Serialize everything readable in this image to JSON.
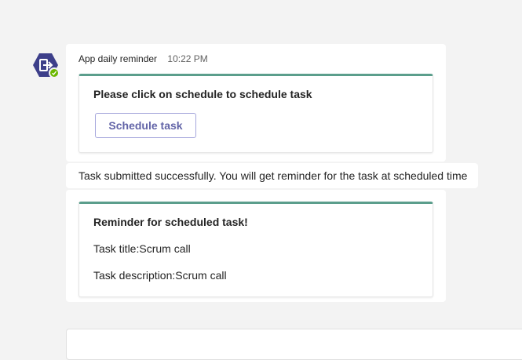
{
  "colors": {
    "background": "#f3f3f3",
    "accent": "#5b9e8c",
    "button_text": "#6264a7",
    "avatar_bg": "#3d3f8a",
    "status_online": "#6bb700"
  },
  "avatar": {
    "icon": "app-exit-icon",
    "status": "available"
  },
  "message": {
    "sender": "App daily reminder",
    "timestamp": "10:22 PM",
    "card1": {
      "text": "Please click on schedule to schedule task",
      "button_label": "Schedule task"
    },
    "confirmation": "Task submitted successfully. You will get reminder for the task at scheduled time",
    "card2": {
      "title": "Reminder for scheduled task!",
      "task_title": "Task title:Scrum call",
      "task_description": "Task description:Scrum call"
    }
  }
}
